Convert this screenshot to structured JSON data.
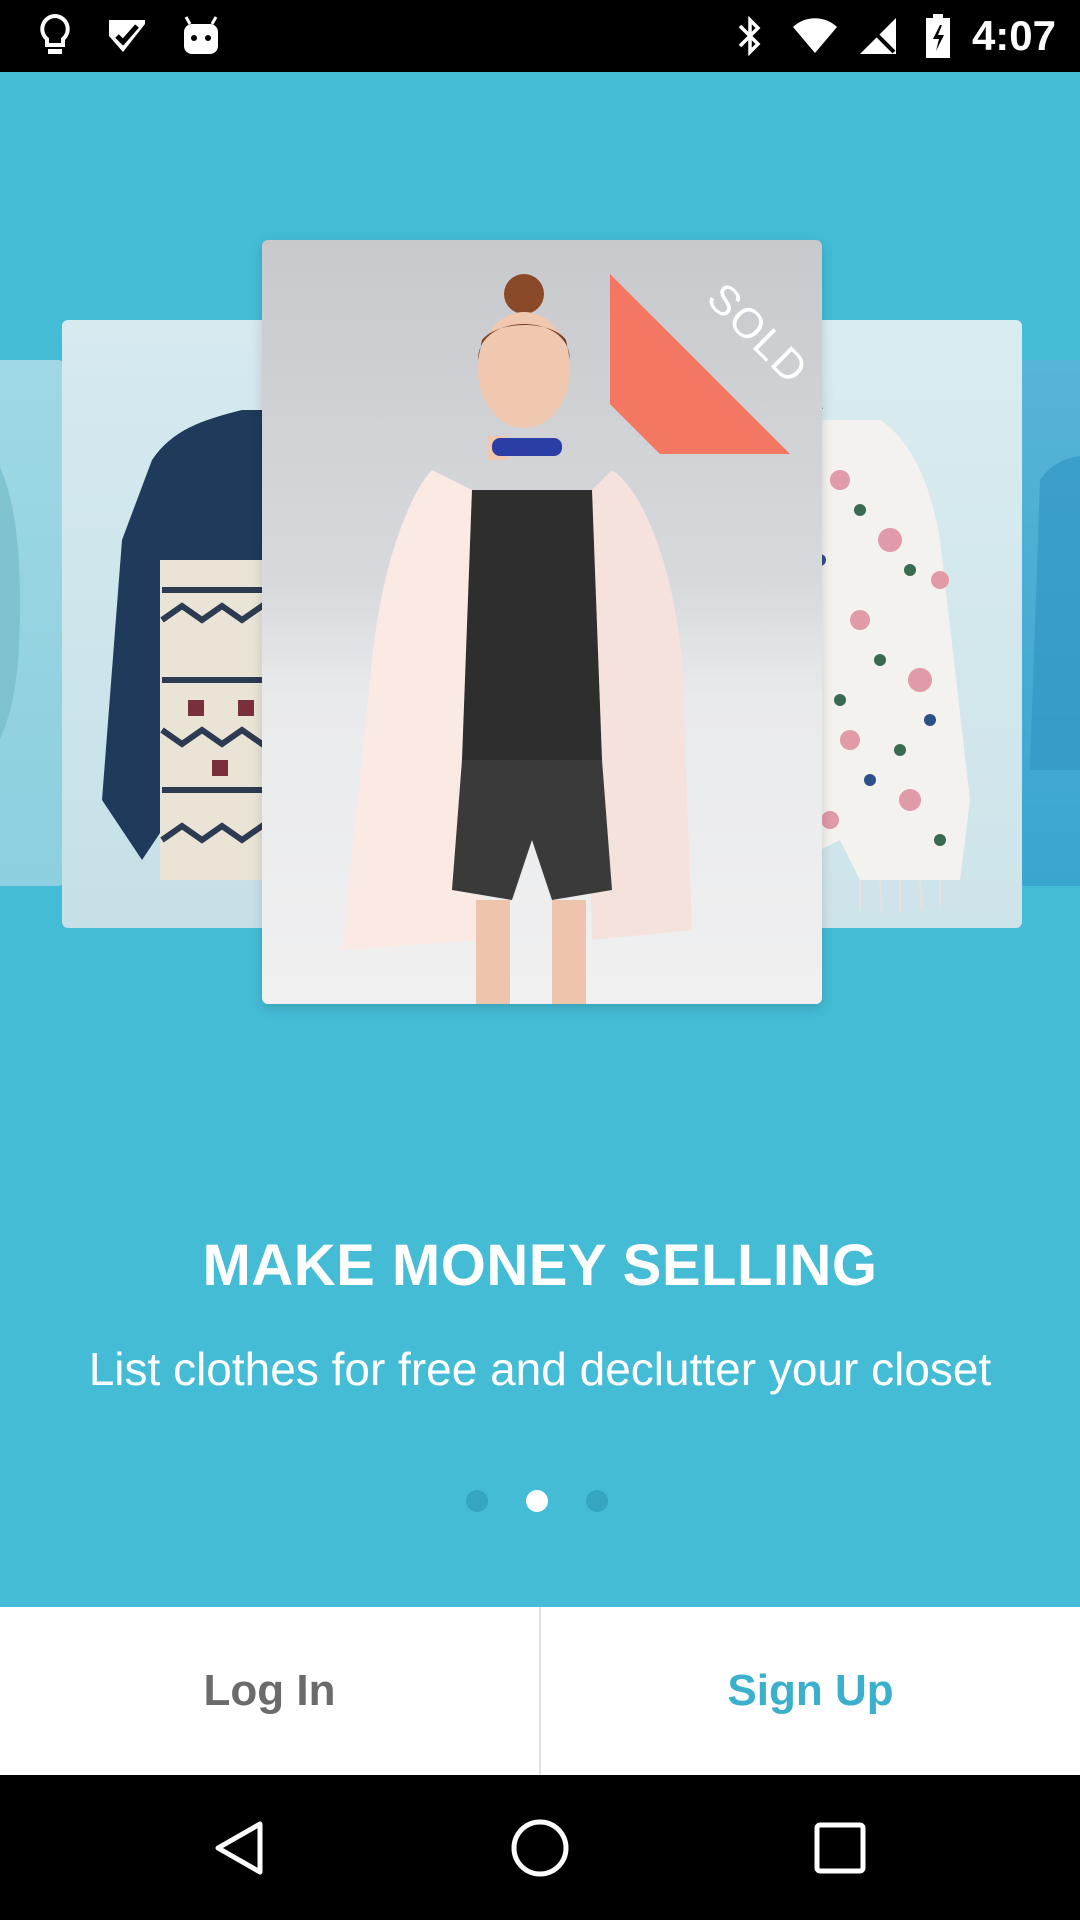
{
  "status_bar": {
    "time": "4:07",
    "left_icons": [
      "lightbulb-icon",
      "check-icon",
      "android-icon"
    ],
    "right_icons": [
      "bluetooth-icon",
      "wifi-icon",
      "signal-off-icon",
      "battery-icon"
    ]
  },
  "carousel": {
    "cards": [
      "coat-photo",
      "sold-woman-photo",
      "floral-jacket-photo"
    ],
    "ribbon_label": "SOLD",
    "headline": "MAKE MONEY SELLING",
    "subtitle": "List clothes for free and declutter your closet",
    "page_count": 3,
    "active_page": 2
  },
  "auth": {
    "login_label": "Log In",
    "signup_label": "Sign Up"
  },
  "nav_bar": {
    "items": [
      "back-icon",
      "home-icon",
      "recents-icon"
    ]
  },
  "colors": {
    "background": "#44bcd6",
    "accent": "#3bb0cc",
    "ribbon": "#f47763"
  }
}
